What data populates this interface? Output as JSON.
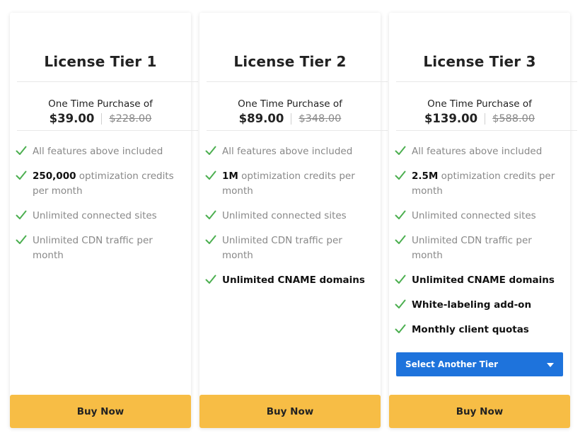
{
  "colors": {
    "accent_blue": "#1e73dc",
    "buy_yellow": "#f7bd45",
    "check_green": "#4caf50"
  },
  "tiers": [
    {
      "title": "License Tier 1",
      "purchase_label": "One Time Purchase of",
      "price": "$39.00",
      "old_price": "$228.00",
      "features": [
        {
          "bold": "",
          "text": "All features above included"
        },
        {
          "bold": "250,000",
          "text": " optimization credits per month"
        },
        {
          "bold": "",
          "text": "Unlimited connected sites"
        },
        {
          "bold": "",
          "text": "Unlimited CDN traffic per month"
        }
      ],
      "buy_label": "Buy Now"
    },
    {
      "title": "License Tier 2",
      "purchase_label": "One Time Purchase of",
      "price": "$89.00",
      "old_price": "$348.00",
      "features": [
        {
          "bold": "",
          "text": "All features above included"
        },
        {
          "bold": "1M",
          "text": " optimization credits per month"
        },
        {
          "bold": "",
          "text": "Unlimited connected sites"
        },
        {
          "bold": "",
          "text": "Unlimited CDN traffic per month"
        },
        {
          "bold": "Unlimited CNAME domains",
          "text": ""
        }
      ],
      "buy_label": "Buy Now"
    },
    {
      "title": "License Tier 3",
      "purchase_label": "One Time Purchase of",
      "price": "$139.00",
      "old_price": "$588.00",
      "features": [
        {
          "bold": "",
          "text": "All features above included"
        },
        {
          "bold": "2.5M",
          "text": " optimization credits per month"
        },
        {
          "bold": "",
          "text": "Unlimited connected sites"
        },
        {
          "bold": "",
          "text": "Unlimited CDN traffic per month"
        },
        {
          "bold": "Unlimited CNAME domains",
          "text": ""
        },
        {
          "bold": "White-labeling add-on",
          "text": ""
        },
        {
          "bold": "Monthly client quotas",
          "text": ""
        }
      ],
      "select_label": "Select Another Tier",
      "buy_label": "Buy Now"
    }
  ]
}
